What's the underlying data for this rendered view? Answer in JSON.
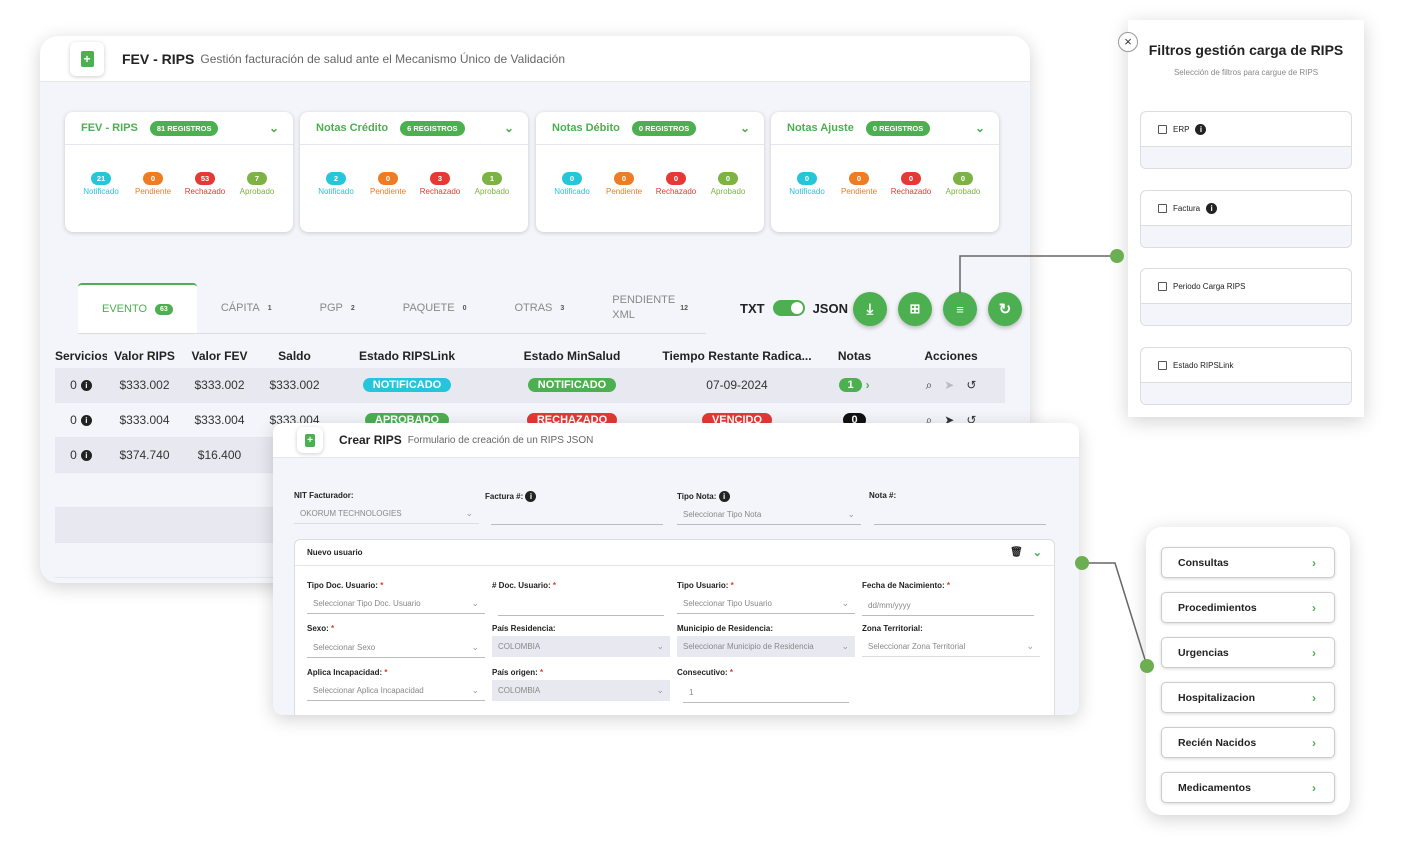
{
  "header": {
    "title": "FEV - RIPS",
    "subtitle": "Gestión facturación de salud ante el Mecanismo Único de Validación"
  },
  "cards": [
    {
      "title": "FEV - RIPS",
      "badge": "81 REGISTROS",
      "stats": [
        {
          "value": "21",
          "label": "Notificado"
        },
        {
          "value": "0",
          "label": "Pendiente"
        },
        {
          "value": "53",
          "label": "Rechazado"
        },
        {
          "value": "7",
          "label": "Aprobado"
        }
      ]
    },
    {
      "title": "Notas Crédito",
      "badge": "6 REGISTROS",
      "stats": [
        {
          "value": "2",
          "label": "Notificado"
        },
        {
          "value": "0",
          "label": "Pendiente"
        },
        {
          "value": "3",
          "label": "Rechazado"
        },
        {
          "value": "1",
          "label": "Aprobado"
        }
      ]
    },
    {
      "title": "Notas Débito",
      "badge": "0 REGISTROS",
      "stats": [
        {
          "value": "0",
          "label": "Notificado"
        },
        {
          "value": "0",
          "label": "Pendiente"
        },
        {
          "value": "0",
          "label": "Rechazado"
        },
        {
          "value": "0",
          "label": "Aprobado"
        }
      ]
    },
    {
      "title": "Notas Ajuste",
      "badge": "0 REGISTROS",
      "stats": [
        {
          "value": "0",
          "label": "Notificado"
        },
        {
          "value": "0",
          "label": "Pendiente"
        },
        {
          "value": "0",
          "label": "Rechazado"
        },
        {
          "value": "0",
          "label": "Aprobado"
        }
      ]
    }
  ],
  "tabs": [
    {
      "label": "EVENTO",
      "count": "63"
    },
    {
      "label": "CÁPITA",
      "count": "1"
    },
    {
      "label": "PGP",
      "count": "2"
    },
    {
      "label": "PAQUETE",
      "count": "0"
    },
    {
      "label": "OTRAS",
      "count": "3"
    },
    {
      "label": "PENDIENTE XML",
      "count": "12"
    }
  ],
  "toggle": {
    "left": "TXT",
    "right": "JSON"
  },
  "table": {
    "headers": [
      "Servicios",
      "Valor RIPS",
      "Valor FEV",
      "Saldo",
      "Estado RIPSLink",
      "Estado MinSalud",
      "Tiempo Restante Radica...",
      "Notas",
      "Acciones"
    ],
    "rows": [
      {
        "servicios": "0",
        "valor_rips": "$333.002",
        "valor_fev": "$333.002",
        "saldo": "$333.002",
        "estado_ripslink": "NOTIFICADO",
        "estado_minsalud": "NOTIFICADO",
        "tiempo": "07-09-2024",
        "notas": "1"
      },
      {
        "servicios": "0",
        "valor_rips": "$333.004",
        "valor_fev": "$333.004",
        "saldo": "$333.004",
        "estado_ripslink": "APROBADO",
        "estado_minsalud": "RECHAZADO",
        "tiempo": "VENCIDO",
        "notas": "0"
      },
      {
        "servicios": "0",
        "valor_rips": "$374.740",
        "valor_fev": "$16.400",
        "saldo": "",
        "estado_ripslink": "",
        "estado_minsalud": "",
        "tiempo": "",
        "notas": ""
      }
    ]
  },
  "filters": {
    "title": "Filtros gestión carga de RIPS",
    "subtitle": "Selección de filtros para cargue de RIPS",
    "items": [
      "ERP",
      "Factura",
      "Periodo Carga RIPS",
      "Estado RIPSLink"
    ]
  },
  "create": {
    "title": "Crear RIPS",
    "subtitle": "Formulario de creación de un RIPS JSON",
    "nit_label": "NIT Facturador:",
    "nit_value": "OKORUM TECHNOLOGIES",
    "factura_label": "Factura #:",
    "tipo_nota_label": "Tipo Nota:",
    "tipo_nota_placeholder": "Seleccionar Tipo Nota",
    "nota_label": "Nota #:",
    "section_title": "Nuevo usuario",
    "fields": {
      "tipo_doc_label": "Tipo Doc. Usuario:",
      "tipo_doc_placeholder": "Seleccionar Tipo Doc. Usuario",
      "num_doc_label": "# Doc. Usuario:",
      "tipo_usuario_label": "Tipo Usuario:",
      "tipo_usuario_placeholder": "Seleccionar Tipo Usuario",
      "fecha_label": "Fecha de Nacimiento:",
      "fecha_placeholder": "dd/mm/yyyy",
      "sexo_label": "Sexo:",
      "sexo_placeholder": "Seleccionar Sexo",
      "pais_res_label": "País Residencia:",
      "pais_res_value": "COLOMBIA",
      "municipio_label": "Municipio de Residencia:",
      "municipio_placeholder": "Seleccionar Municipio de Residencia",
      "zona_label": "Zona Territorial:",
      "zona_placeholder": "Seleccionar Zona Territorial",
      "incapacidad_label": "Aplica Incapacidad:",
      "incapacidad_placeholder": "Seleccionar Aplica Incapacidad",
      "pais_origen_label": "País origen:",
      "pais_origen_value": "COLOMBIA",
      "consecutivo_label": "Consecutivo:",
      "consecutivo_value": "1"
    }
  },
  "services_menu": [
    "Consultas",
    "Procedimientos",
    "Urgencias",
    "Hospitalizacion",
    "Recién Nacidos",
    "Medicamentos"
  ],
  "colors": {
    "accent": "#4caf50",
    "notificado": "#26c6da",
    "pendiente": "#ef7b22",
    "rechazado": "#e53935",
    "aprobado": "#7cb342"
  }
}
